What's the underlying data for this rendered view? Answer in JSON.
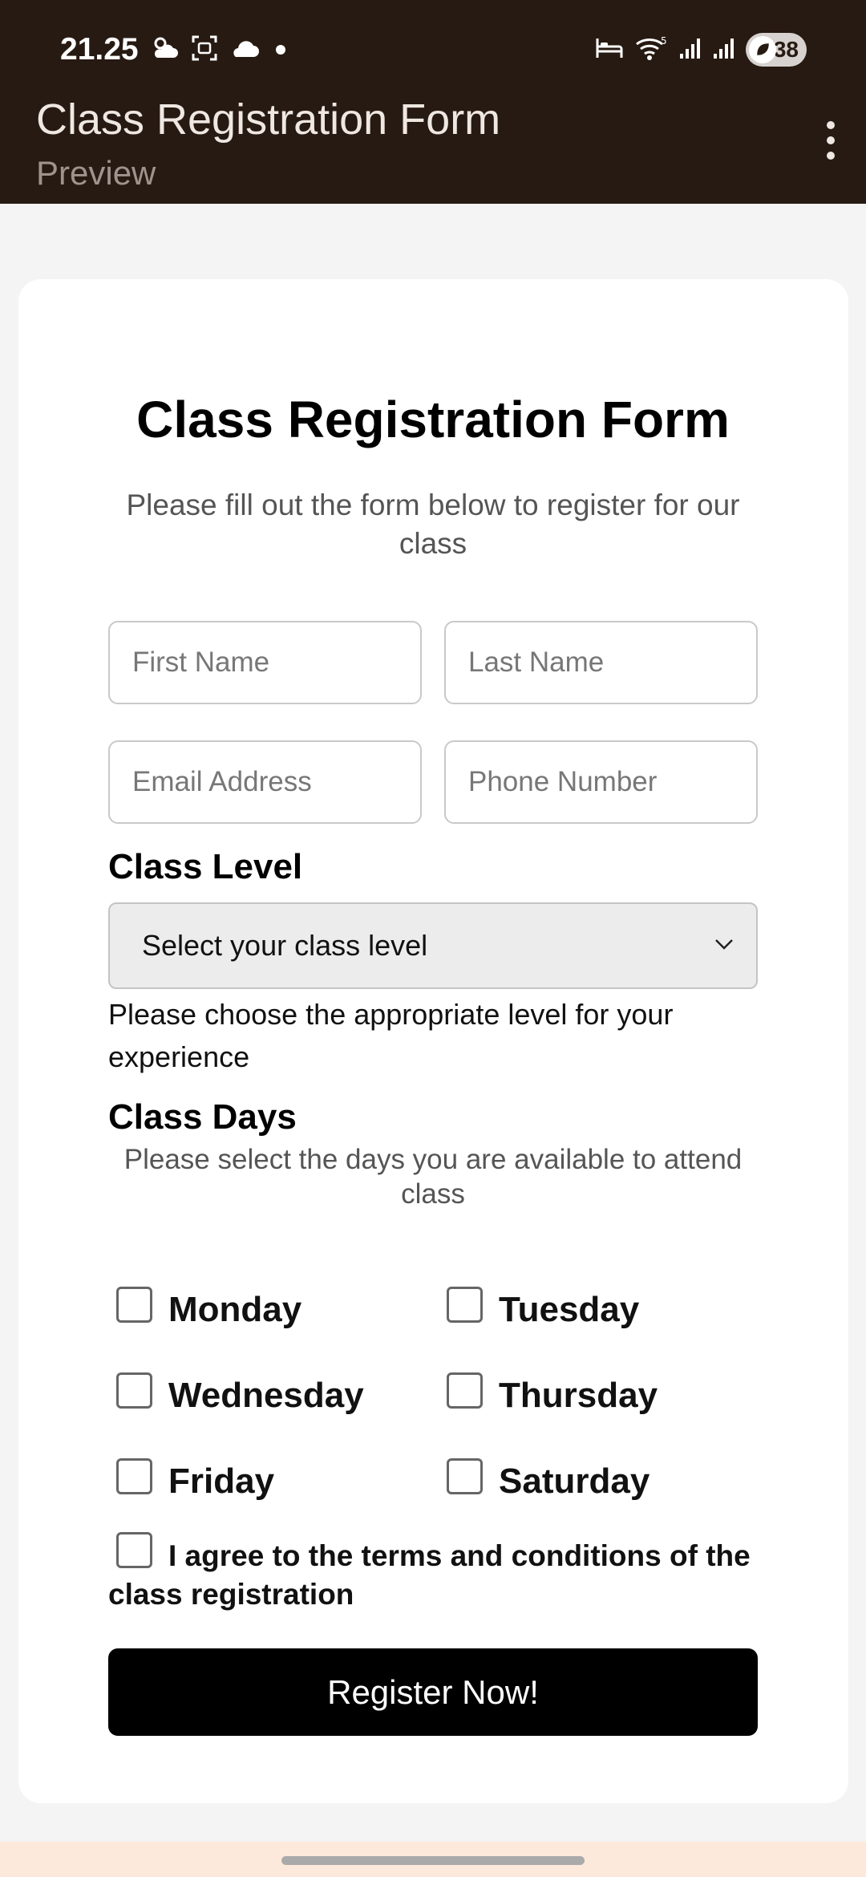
{
  "status_bar": {
    "time": "21.25",
    "battery": "38",
    "left_icons": [
      "weather-icon",
      "screenshot-icon",
      "cloud-icon",
      "dot-icon"
    ],
    "right_icons": [
      "bed-icon",
      "wifi-icon",
      "signal-icon",
      "signal-icon"
    ]
  },
  "app_bar": {
    "title": "Class Registration Form",
    "subtitle": "Preview",
    "menu_icon": "more-vert-icon"
  },
  "form": {
    "title": "Class Registration Form",
    "subtitle": "Please fill out the form below to register for our class",
    "fields": {
      "first_name": {
        "placeholder": "First Name",
        "value": ""
      },
      "last_name": {
        "placeholder": "Last Name",
        "value": ""
      },
      "email": {
        "placeholder": "Email Address",
        "value": ""
      },
      "phone": {
        "placeholder": "Phone Number",
        "value": ""
      }
    },
    "class_level": {
      "label": "Class Level",
      "selected": "Select your class level",
      "helper": "Please choose the appropriate level for your experience"
    },
    "class_days": {
      "label": "Class Days",
      "helper": "Please select the days you are available to attend class",
      "days": [
        {
          "label": "Monday",
          "checked": false
        },
        {
          "label": "Tuesday",
          "checked": false
        },
        {
          "label": "Wednesday",
          "checked": false
        },
        {
          "label": "Thursday",
          "checked": false
        },
        {
          "label": "Friday",
          "checked": false
        },
        {
          "label": "Saturday",
          "checked": false
        }
      ]
    },
    "terms": {
      "label": "I agree to the terms and conditions of the class registration",
      "checked": false
    },
    "submit_label": "Register Now!"
  },
  "colors": {
    "app_bar_bg": "#271a12",
    "page_bg": "#f4f4f4",
    "button_bg": "#000000",
    "bottom_strip": "#fde9dc"
  }
}
